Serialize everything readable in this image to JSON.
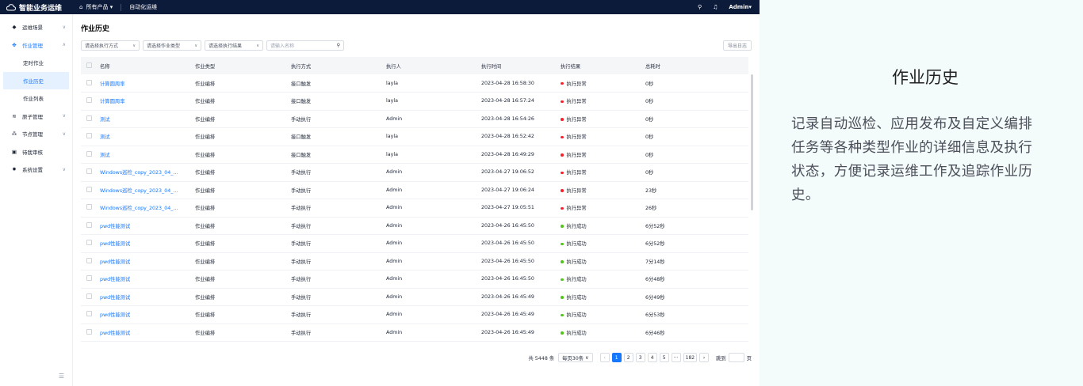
{
  "app": {
    "title": "智能业务运维"
  },
  "topnav": {
    "products": "所有产品",
    "section": "自动化运维"
  },
  "user": {
    "name": "Admin"
  },
  "sidebar": {
    "items": [
      {
        "label": "运维场景",
        "icon": "cube-icon"
      },
      {
        "label": "作业管理",
        "icon": "job-icon"
      },
      {
        "label": "定时作业"
      },
      {
        "label": "作业历史"
      },
      {
        "label": "作业列表"
      },
      {
        "label": "原子管理",
        "icon": "stack-icon"
      },
      {
        "label": "节点管理",
        "icon": "nodes-icon"
      },
      {
        "label": "待我审核",
        "icon": "review-icon"
      },
      {
        "label": "系统设置",
        "icon": "gear-icon"
      }
    ]
  },
  "page": {
    "title": "作业历史",
    "filters": {
      "exec_mode": "请选择执行方式",
      "job_type": "请选择作业类型",
      "exec_result": "请选择执行结果",
      "name_placeholder": "请输入名称"
    },
    "export_label": "导出日志"
  },
  "table": {
    "columns": [
      "名称",
      "作业类型",
      "执行方式",
      "执行人",
      "执行时间",
      "执行结果",
      "总耗时"
    ],
    "rows": [
      [
        "计算圆周率",
        "作业编排",
        "接口触发",
        "layla",
        "2023-04-28 16:58:30",
        "执行异常",
        "0秒"
      ],
      [
        "计算圆周率",
        "作业编排",
        "接口触发",
        "layla",
        "2023-04-28 16:57:24",
        "执行异常",
        "0秒"
      ],
      [
        "测试",
        "作业编排",
        "手动执行",
        "Admin",
        "2023-04-28 16:54:26",
        "执行异常",
        "0秒"
      ],
      [
        "测试",
        "作业编排",
        "接口触发",
        "layla",
        "2023-04-28 16:52:42",
        "执行异常",
        "0秒"
      ],
      [
        "测试",
        "作业编排",
        "接口触发",
        "layla",
        "2023-04-28 16:49:29",
        "执行异常",
        "0秒"
      ],
      [
        "Windows巡检_copy_2023_04_...",
        "作业编排",
        "手动执行",
        "Admin",
        "2023-04-27 19:06:52",
        "执行异常",
        "0秒"
      ],
      [
        "Windows巡检_copy_2023_04_...",
        "作业编排",
        "手动执行",
        "Admin",
        "2023-04-27 19:06:24",
        "执行异常",
        "23秒"
      ],
      [
        "Windows巡检_copy_2023_04_...",
        "作业编排",
        "手动执行",
        "Admin",
        "2023-04-27 19:05:51",
        "执行异常",
        "26秒"
      ],
      [
        "pwd性能测试",
        "作业编排",
        "手动执行",
        "Admin",
        "2023-04-26 16:45:50",
        "执行成功",
        "6分52秒"
      ],
      [
        "pwd性能测试",
        "作业编排",
        "手动执行",
        "Admin",
        "2023-04-26 16:45:50",
        "执行成功",
        "6分52秒"
      ],
      [
        "pwd性能测试",
        "作业编排",
        "手动执行",
        "Admin",
        "2023-04-26 16:45:50",
        "执行成功",
        "7分14秒"
      ],
      [
        "pwd性能测试",
        "作业编排",
        "手动执行",
        "Admin",
        "2023-04-26 16:45:50",
        "执行成功",
        "6分48秒"
      ],
      [
        "pwd性能测试",
        "作业编排",
        "手动执行",
        "Admin",
        "2023-04-26 16:45:49",
        "执行成功",
        "6分49秒"
      ],
      [
        "pwd性能测试",
        "作业编排",
        "手动执行",
        "Admin",
        "2023-04-26 16:45:49",
        "执行成功",
        "6分53秒"
      ],
      [
        "pwd性能测试",
        "作业编排",
        "手动执行",
        "Admin",
        "2023-04-26 16:45:49",
        "执行成功",
        "6分46秒"
      ]
    ],
    "status_colors": {
      "执行异常": "#f5222d",
      "执行成功": "#52c41a"
    }
  },
  "pagination": {
    "total": "共 5448 条",
    "page_size": "每页30条",
    "pages": [
      "1",
      "2",
      "3",
      "4",
      "5",
      "···",
      "182"
    ],
    "jump_label": "跳到",
    "page_suffix": "页"
  },
  "description": {
    "title": "作业历史",
    "text": "记录自动巡检、应用发布及自定义编排任务等各种类型作业的详细信息及执行状态，方便记录运维工作及追踪作业历史。"
  },
  "colors": {
    "topbar": "#0d1b3a",
    "accent": "#1677ff",
    "error": "#f5222d",
    "success": "#52c41a"
  }
}
